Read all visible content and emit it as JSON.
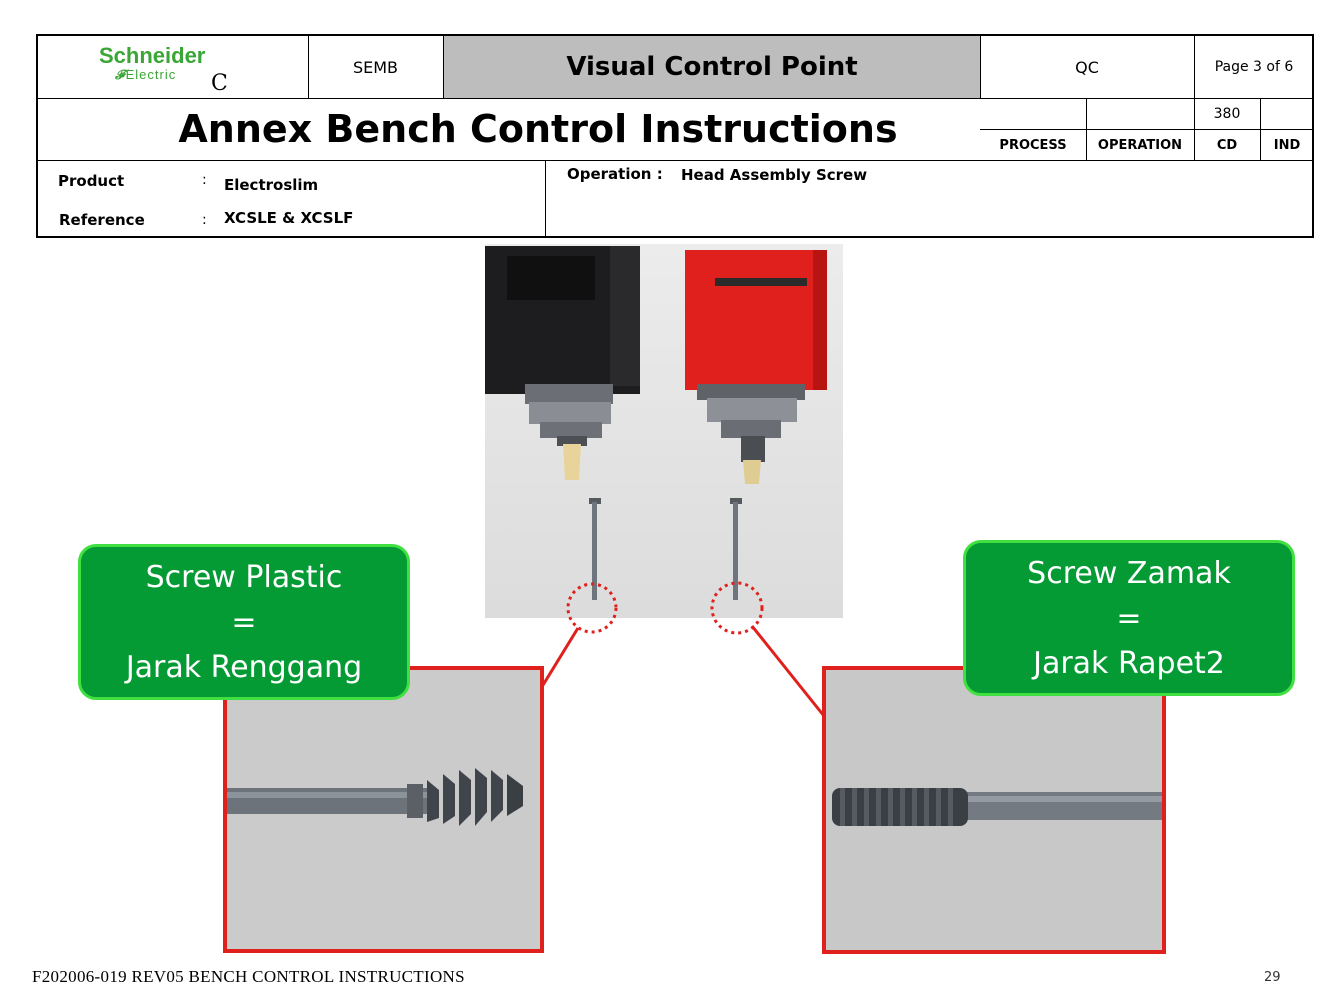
{
  "header": {
    "logo_brand": "Schneider",
    "logo_sub": "Electric",
    "logo_extra": "C",
    "dept": "SEMB",
    "title": "Visual Control Point",
    "qc": "QC",
    "page": "Page 3 of 6",
    "main_title": "Annex Bench Control Instructions",
    "code_value": "380",
    "col_process": "PROCESS",
    "col_operation": "OPERATION",
    "col_cd": "CD",
    "col_ind": "IND"
  },
  "info": {
    "product_label": "Product",
    "product_colon": ":",
    "product_value": "Electroslim",
    "reference_label": "Reference",
    "reference_colon": ":",
    "reference_value": "XCSLE & XCSLF",
    "operation_label": "Operation :",
    "operation_value": "Head Assembly Screw"
  },
  "callouts": {
    "left": {
      "line1": "Screw Plastic",
      "line2": "=",
      "line3": "Jarak Renggang"
    },
    "right": {
      "line1": "Screw Zamak",
      "line2": "=",
      "line3": "Jarak Rapet2"
    }
  },
  "footer": {
    "doc_code": "F202006-019 REV05 BENCH CONTROL INSTRUCTIONS",
    "page_number": "29"
  },
  "colors": {
    "brand_green": "#3aa635",
    "callout_green": "#049a34",
    "callout_border": "#3fe03f",
    "highlight_red": "#e0201c",
    "title_gray": "#bdbdbd"
  }
}
